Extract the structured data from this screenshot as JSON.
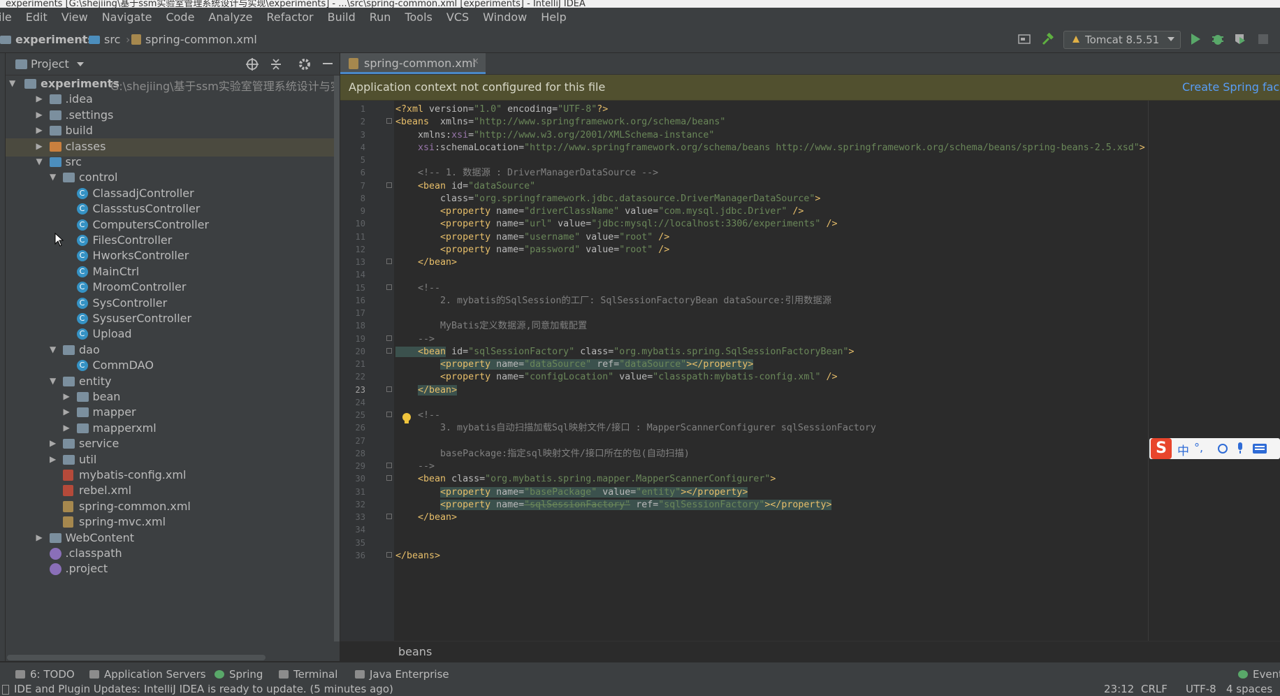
{
  "window": {
    "title": "experiments [G:\\shejiing\\基于ssm实验室管理系统设计与实现\\experiments] - ...\\src\\spring-common.xml [experiments] - IntelliJ IDEA"
  },
  "menu": [
    "ile",
    "Edit",
    "View",
    "Navigate",
    "Code",
    "Analyze",
    "Refactor",
    "Build",
    "Run",
    "Tools",
    "VCS",
    "Window",
    "Help"
  ],
  "breadcrumb": {
    "project": "experiments",
    "folder": "src",
    "file": "spring-common.xml"
  },
  "run_config": {
    "label": "Tomcat 8.5.51"
  },
  "project_panel": {
    "title": "Project",
    "root_name": "experiments",
    "root_path": "G:\\shejiing\\基于ssm实验室管理系统设计与实现\\e",
    "items": [
      {
        "label": ".idea",
        "depth": 1,
        "type": "folder",
        "arrow": "right"
      },
      {
        "label": ".settings",
        "depth": 1,
        "type": "folder",
        "arrow": "right"
      },
      {
        "label": "build",
        "depth": 1,
        "type": "folder",
        "arrow": "right"
      },
      {
        "label": "classes",
        "depth": 1,
        "type": "orange",
        "arrow": "right",
        "selected": true
      },
      {
        "label": "src",
        "depth": 1,
        "type": "src",
        "arrow": "down"
      },
      {
        "label": "control",
        "depth": 2,
        "type": "folder",
        "arrow": "down"
      },
      {
        "label": "ClassadjController",
        "depth": 3,
        "type": "cls"
      },
      {
        "label": "ClassstusController",
        "depth": 3,
        "type": "cls"
      },
      {
        "label": "ComputersController",
        "depth": 3,
        "type": "cls"
      },
      {
        "label": "FilesController",
        "depth": 3,
        "type": "cls"
      },
      {
        "label": "HworksController",
        "depth": 3,
        "type": "cls"
      },
      {
        "label": "MainCtrl",
        "depth": 3,
        "type": "cls"
      },
      {
        "label": "MroomController",
        "depth": 3,
        "type": "cls"
      },
      {
        "label": "SysController",
        "depth": 3,
        "type": "cls"
      },
      {
        "label": "SysuserController",
        "depth": 3,
        "type": "cls"
      },
      {
        "label": "Upload",
        "depth": 3,
        "type": "cls"
      },
      {
        "label": "dao",
        "depth": 2,
        "type": "folder",
        "arrow": "down"
      },
      {
        "label": "CommDAO",
        "depth": 3,
        "type": "cls"
      },
      {
        "label": "entity",
        "depth": 2,
        "type": "folder",
        "arrow": "down"
      },
      {
        "label": "bean",
        "depth": 3,
        "type": "folder",
        "arrow": "right"
      },
      {
        "label": "mapper",
        "depth": 3,
        "type": "folder",
        "arrow": "right"
      },
      {
        "label": "mapperxml",
        "depth": 3,
        "type": "folder",
        "arrow": "right"
      },
      {
        "label": "service",
        "depth": 2,
        "type": "folder",
        "arrow": "right"
      },
      {
        "label": "util",
        "depth": 2,
        "type": "folder",
        "arrow": "right"
      },
      {
        "label": "mybatis-config.xml",
        "depth": 2,
        "type": "xmlr"
      },
      {
        "label": "rebel.xml",
        "depth": 2,
        "type": "xmlr"
      },
      {
        "label": "spring-common.xml",
        "depth": 2,
        "type": "xml"
      },
      {
        "label": "spring-mvc.xml",
        "depth": 2,
        "type": "xml"
      },
      {
        "label": "WebContent",
        "depth": 1,
        "type": "folder",
        "arrow": "right"
      },
      {
        "label": ".classpath",
        "depth": 1,
        "type": "ecl"
      },
      {
        "label": ".project",
        "depth": 1,
        "type": "ecl"
      }
    ]
  },
  "editor": {
    "tab": "spring-common.xml",
    "banner_message": "Application context not configured for this file",
    "banner_action": "Create Spring facet",
    "current_line": 23,
    "lines": [
      [
        [
          "tag",
          "<?xml "
        ],
        [
          "attr",
          "version="
        ],
        [
          "val",
          "\"1.0\""
        ],
        [
          "attr",
          " encoding="
        ],
        [
          "val",
          "\"UTF-8\""
        ],
        [
          "tag",
          "?>"
        ]
      ],
      [
        [
          "tag",
          "<beans  "
        ],
        [
          "attr",
          "xmlns="
        ],
        [
          "val",
          "\"http://www.springframework.org/schema/beans\""
        ]
      ],
      [
        [
          "attr",
          "    xmlns:"
        ],
        [
          "ns",
          "xsi"
        ],
        [
          "attr",
          "="
        ],
        [
          "val",
          "\"http://www.w3.org/2001/XMLSchema-instance\""
        ]
      ],
      [
        [
          "ns",
          "    xsi"
        ],
        [
          "attr",
          ":schemaLocation="
        ],
        [
          "val",
          "\"http://www.springframework.org/schema/beans http://www.springframework.org/schema/beans/spring-beans-2.5.xsd\""
        ],
        [
          "tag",
          ">"
        ]
      ],
      [],
      [
        [
          "cmt",
          "    <!-- 1. 数据源 : DriverManagerDataSource -->"
        ]
      ],
      [
        [
          "tag",
          "    <bean "
        ],
        [
          "attr",
          "id="
        ],
        [
          "val",
          "\"dataSource\""
        ]
      ],
      [
        [
          "attr",
          "        class="
        ],
        [
          "val",
          "\"org.springframework.jdbc.datasource.DriverManagerDataSource\""
        ],
        [
          "tag",
          ">"
        ]
      ],
      [
        [
          "tag",
          "        <property "
        ],
        [
          "attr",
          "name="
        ],
        [
          "val",
          "\"driverClassName\""
        ],
        [
          "attr",
          " value="
        ],
        [
          "val",
          "\"com.mysql.jdbc.Driver\""
        ],
        [
          "tag",
          " />"
        ]
      ],
      [
        [
          "tag",
          "        <property "
        ],
        [
          "attr",
          "name="
        ],
        [
          "val",
          "\"url\""
        ],
        [
          "attr",
          " value="
        ],
        [
          "val",
          "\"jdbc:mysql://localhost:3306/experiments\""
        ],
        [
          "tag",
          " />"
        ]
      ],
      [
        [
          "tag",
          "        <property "
        ],
        [
          "attr",
          "name="
        ],
        [
          "val",
          "\"username\""
        ],
        [
          "attr",
          " value="
        ],
        [
          "val",
          "\"root\""
        ],
        [
          "tag",
          " />"
        ]
      ],
      [
        [
          "tag",
          "        <property "
        ],
        [
          "attr",
          "name="
        ],
        [
          "val",
          "\"password\""
        ],
        [
          "attr",
          " value="
        ],
        [
          "val",
          "\"root\""
        ],
        [
          "tag",
          " />"
        ]
      ],
      [
        [
          "tag",
          "    </bean>"
        ]
      ],
      [],
      [
        [
          "cmt",
          "    <!--"
        ]
      ],
      [
        [
          "cmt",
          "        2. mybatis的SqlSession的工厂: SqlSessionFactoryBean dataSource:引用数据源"
        ]
      ],
      [],
      [
        [
          "cmt",
          "        MyBatis定义数据源,同意加载配置"
        ]
      ],
      [
        [
          "cmt",
          "    -->"
        ]
      ],
      [
        [
          "tag hl",
          "    <bean"
        ],
        [
          "attr",
          " id="
        ],
        [
          "val",
          "\"sqlSessionFactory\""
        ],
        [
          "attr",
          " class="
        ],
        [
          "val",
          "\"org.mybatis.spring.SqlSessionFactoryBean\""
        ],
        [
          "tag",
          ">"
        ]
      ],
      [
        [
          "attr",
          "        "
        ],
        [
          "tag hl",
          "<property "
        ],
        [
          "attr hl",
          "name="
        ],
        [
          "val hl",
          "\"dataSource\""
        ],
        [
          "attr hl",
          " ref="
        ],
        [
          "val hl",
          "\"dataSource\""
        ],
        [
          "tag hl",
          "></property>"
        ]
      ],
      [
        [
          "tag",
          "        <property "
        ],
        [
          "attr",
          "name="
        ],
        [
          "val",
          "\"configLocation\""
        ],
        [
          "attr",
          " value="
        ],
        [
          "val",
          "\"classpath:mybatis-config.xml\""
        ],
        [
          "tag",
          " />"
        ]
      ],
      [
        [
          "attr",
          "    "
        ],
        [
          "tag hl",
          "</bean>"
        ]
      ],
      [],
      [
        [
          "cmt",
          "    <!--"
        ]
      ],
      [
        [
          "cmt",
          "        3. mybatis自动扫描加载Sql映射文件/接口 : MapperScannerConfigurer sqlSessionFactory"
        ]
      ],
      [],
      [
        [
          "cmt",
          "        basePackage:指定sql映射文件/接口所在的包(自动扫描)"
        ]
      ],
      [
        [
          "cmt",
          "    -->"
        ]
      ],
      [
        [
          "tag",
          "    <bean "
        ],
        [
          "attr",
          "class="
        ],
        [
          "val",
          "\"org.mybatis.spring.mapper.MapperScannerConfigurer\""
        ],
        [
          "tag",
          ">"
        ]
      ],
      [
        [
          "attr",
          "        "
        ],
        [
          "tag hl",
          "<property "
        ],
        [
          "attr hl",
          "name="
        ],
        [
          "val hl",
          "\"basePackage\""
        ],
        [
          "attr hl",
          " value="
        ],
        [
          "val hl",
          "\"entity\""
        ],
        [
          "tag hl",
          "></property>"
        ]
      ],
      [
        [
          "attr",
          "        "
        ],
        [
          "tag hl",
          "<property "
        ],
        [
          "attr hl",
          "name="
        ],
        [
          "val hl strike",
          "\"sqlSessionFactory\""
        ],
        [
          "attr hl",
          " ref="
        ],
        [
          "val hl",
          "\"sqlSessionFactory\""
        ],
        [
          "tag hl",
          "></property>"
        ]
      ],
      [
        [
          "tag",
          "    </bean>"
        ]
      ],
      [],
      [],
      [
        [
          "tag",
          "</beans>"
        ]
      ]
    ],
    "breadcrumb": "beans"
  },
  "tool_windows": [
    "6: TODO",
    "Application Servers",
    "Spring",
    "Terminal",
    "Java Enterprise",
    "Event"
  ],
  "status": {
    "message": "IDE and Plugin Updates: IntelliJ IDEA is ready to update. (5 minutes ago)",
    "position": "23:12",
    "line_sep": "CRLF",
    "encoding": "UTF-8",
    "indent": "4 spaces"
  },
  "ime": {
    "logo": "S",
    "mode": "中"
  }
}
